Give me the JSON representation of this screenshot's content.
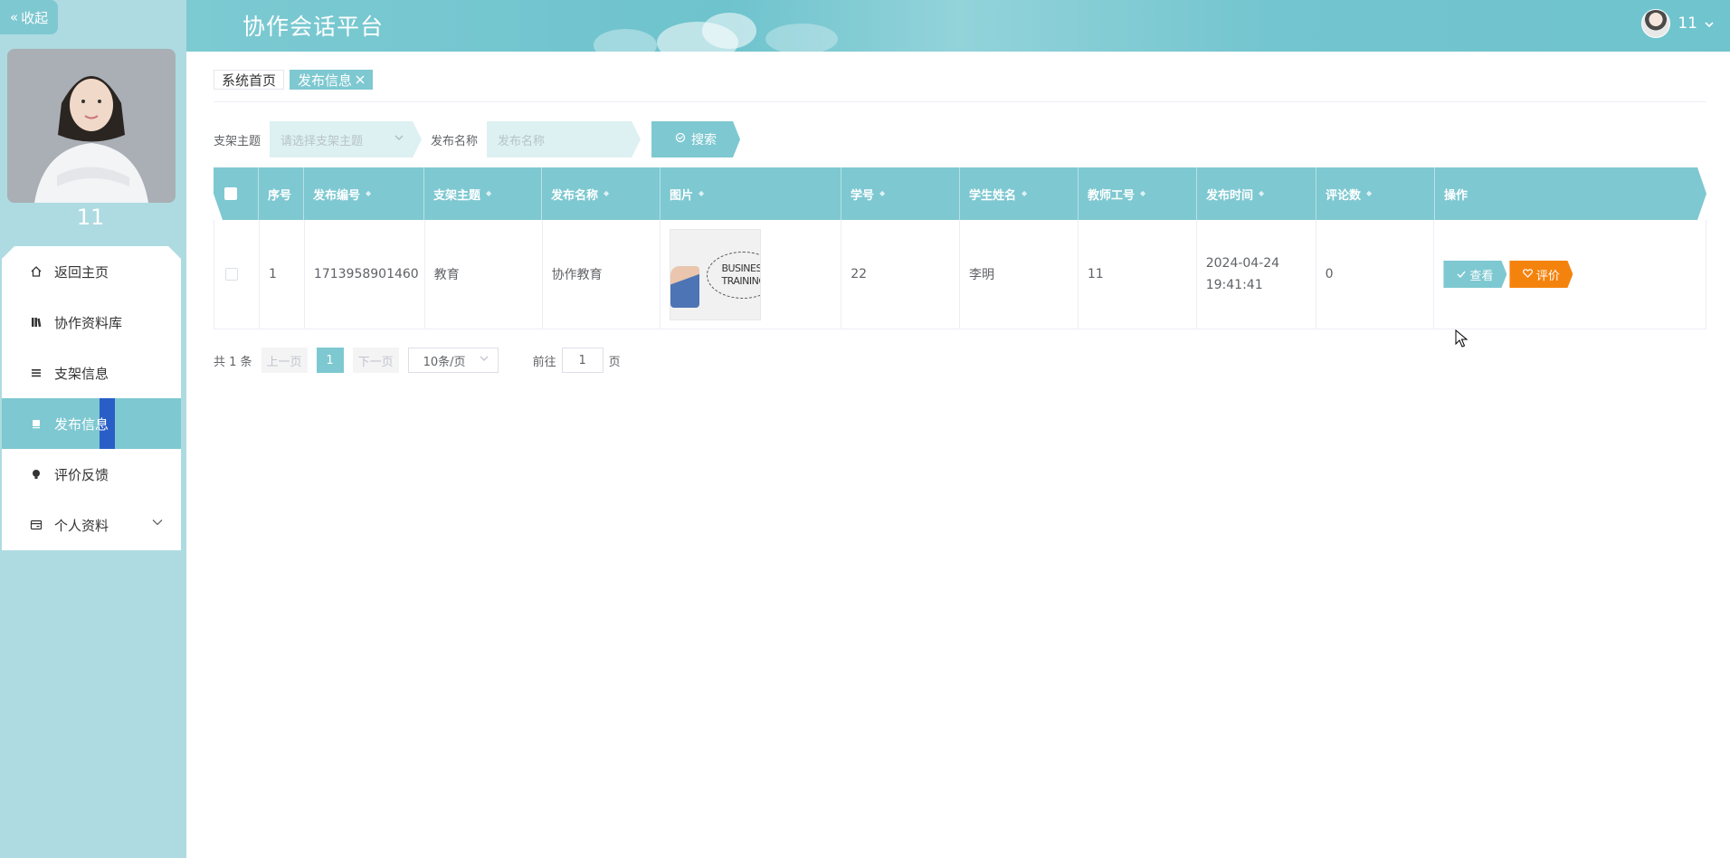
{
  "sidebar": {
    "collapse_label": "收起",
    "username": "11",
    "menu": [
      {
        "label": "返回主页",
        "icon": "home-icon"
      },
      {
        "label": "协作资料库",
        "icon": "library-icon"
      },
      {
        "label": "支架信息",
        "icon": "list-icon"
      },
      {
        "label": "发布信息",
        "icon": "publish-icon",
        "active": true
      },
      {
        "label": "评价反馈",
        "icon": "bulb-icon"
      },
      {
        "label": "个人资料",
        "icon": "profile-icon",
        "has_children": true
      }
    ]
  },
  "header": {
    "title": "协作会话平台",
    "user": "11"
  },
  "tags": [
    {
      "label": "系统首页"
    },
    {
      "label": "发布信息",
      "active": true
    }
  ],
  "search": {
    "topic_label": "支架主题",
    "topic_placeholder": "请选择支架主题",
    "name_label": "发布名称",
    "name_placeholder": "发布名称",
    "button_label": "搜索"
  },
  "table": {
    "columns": [
      "序号",
      "发布编号",
      "支架主题",
      "发布名称",
      "图片",
      "学号",
      "学生姓名",
      "教师工号",
      "发布时间",
      "评论数",
      "操作"
    ],
    "rows": [
      {
        "index": "1",
        "code": "1713958901460",
        "topic": "教育",
        "name": "协作教育",
        "image_text_1": "BUSINESS",
        "image_text_2": "TRAINING",
        "student_no": "22",
        "student_name": "李明",
        "teacher_no": "11",
        "time": "2024-04-24 19:41:41",
        "comments": "0",
        "view_label": "查看",
        "rate_label": "评价"
      }
    ]
  },
  "pagination": {
    "total": "共 1 条",
    "prev": "上一页",
    "page": "1",
    "next": "下一页",
    "page_size": "10条/页",
    "goto_label": "前往",
    "goto_value": "1",
    "page_unit": "页"
  },
  "colors": {
    "primary": "#7ec8d1",
    "sidebar_bg": "#aedbe1",
    "accent_orange": "#f4830e",
    "active_mark": "#2a5ec7"
  }
}
